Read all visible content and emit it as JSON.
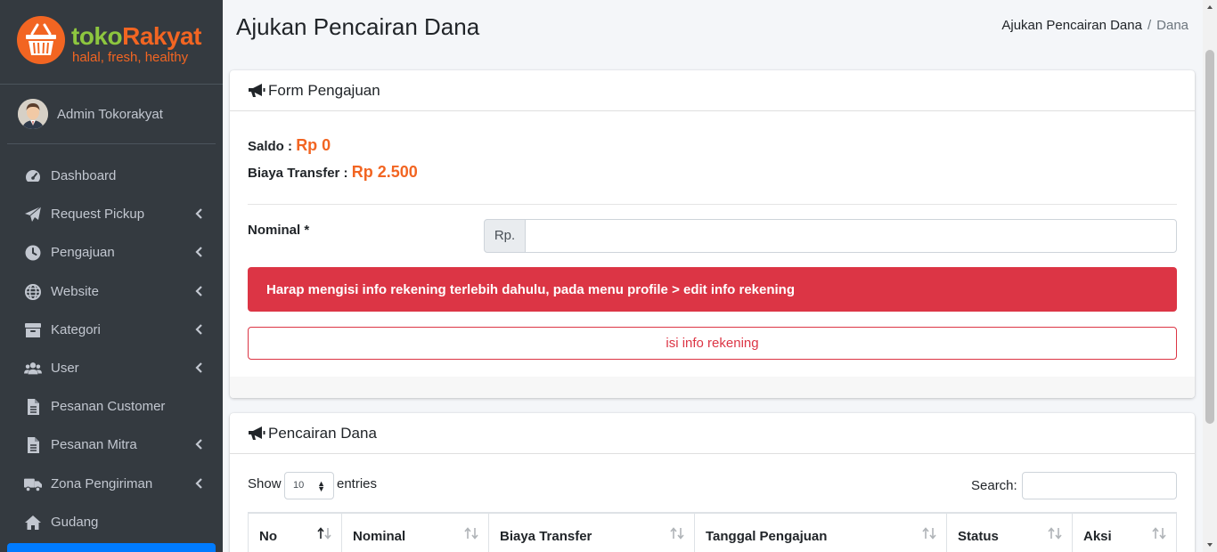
{
  "brand": {
    "name_part1": "toko",
    "name_part2": "Rakyat",
    "tagline": "halal, fresh, healthy"
  },
  "user": {
    "name": "Admin Tokorakyat"
  },
  "sidebar": {
    "items": [
      {
        "label": "Dashboard",
        "icon": "tachometer-icon",
        "has_children": false
      },
      {
        "label": "Request Pickup",
        "icon": "paper-plane-icon",
        "has_children": true
      },
      {
        "label": "Pengajuan",
        "icon": "clock-icon",
        "has_children": true
      },
      {
        "label": "Website",
        "icon": "globe-icon",
        "has_children": true
      },
      {
        "label": "Kategori",
        "icon": "archive-icon",
        "has_children": true
      },
      {
        "label": "User",
        "icon": "users-icon",
        "has_children": true
      },
      {
        "label": "Pesanan Customer",
        "icon": "file-icon",
        "has_children": false
      },
      {
        "label": "Pesanan Mitra",
        "icon": "file-icon",
        "has_children": true
      },
      {
        "label": "Zona Pengiriman",
        "icon": "truck-icon",
        "has_children": true
      },
      {
        "label": "Gudang",
        "icon": "home-icon",
        "has_children": false
      }
    ]
  },
  "header": {
    "title": "Ajukan Pencairan Dana",
    "breadcrumb": {
      "link": "Ajukan Pencairan Dana",
      "separator": "/",
      "active": "Dana"
    }
  },
  "form_card": {
    "title": "Form Pengajuan",
    "saldo_label": "Saldo :",
    "saldo_value": "Rp 0",
    "biaya_label": "Biaya Transfer :",
    "biaya_value": "Rp 2.500",
    "nominal_label": "Nominal *",
    "nominal_prefix": "Rp.",
    "nominal_value": "",
    "alert_text": "Harap mengisi info rekening terlebih dahulu, pada menu profile > edit info rekening",
    "button_label": "isi info rekening"
  },
  "table_card": {
    "title": "Pencairan Dana",
    "show_label": "Show",
    "entries_value": "10",
    "entries_label": "entries",
    "search_label": "Search:",
    "columns": [
      "No",
      "Nominal",
      "Biaya Transfer",
      "Tanggal Pengajuan",
      "Status",
      "Aksi"
    ]
  },
  "colors": {
    "sidebar_bg": "#343a40",
    "accent_orange": "#f26522",
    "brand_green": "#8dc63f",
    "danger": "#dc3545",
    "primary": "#007bff"
  }
}
